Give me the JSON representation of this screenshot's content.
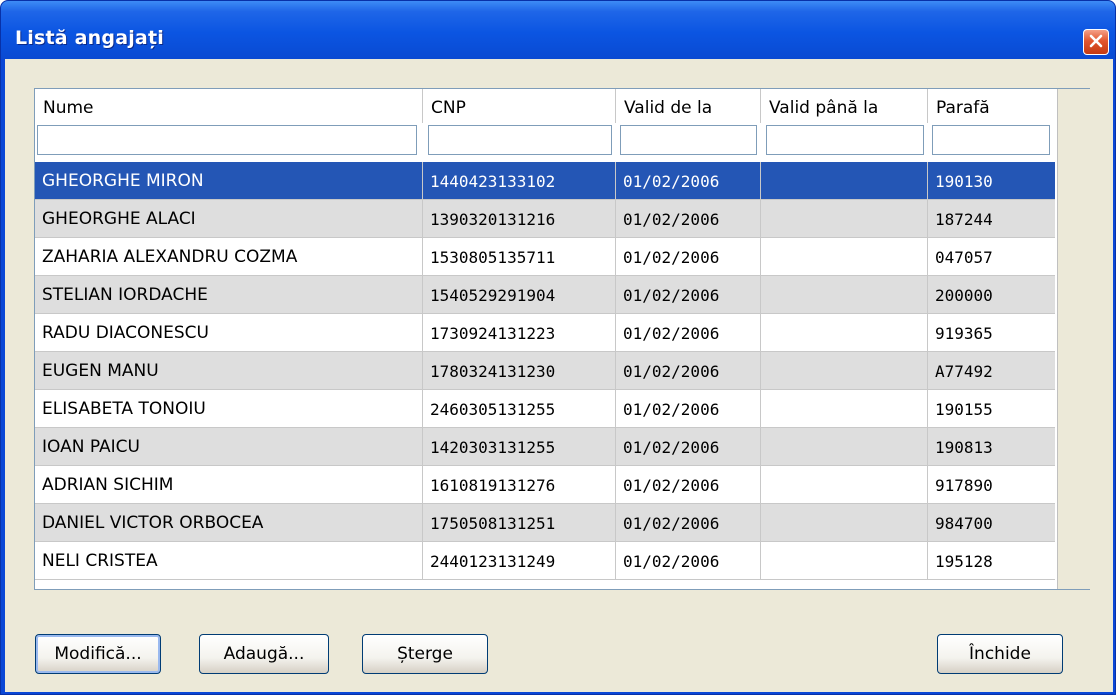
{
  "window": {
    "title": "Listă angajați",
    "close_icon": "close-icon"
  },
  "table": {
    "columns": [
      "Nume",
      "CNP",
      "Valid de la",
      "Valid până la",
      "Parafă"
    ],
    "filters": [
      "",
      "",
      "",
      "",
      ""
    ],
    "rows": [
      {
        "nume": "GHEORGHE MIRON",
        "cnp": "1440423133102",
        "valid_de_la": "01/02/2006",
        "valid_pana_la": "",
        "parafa": "190130"
      },
      {
        "nume": "GHEORGHE ALACI",
        "cnp": "1390320131216",
        "valid_de_la": "01/02/2006",
        "valid_pana_la": "",
        "parafa": "187244"
      },
      {
        "nume": "ZAHARIA ALEXANDRU COZMA",
        "cnp": "1530805135711",
        "valid_de_la": "01/02/2006",
        "valid_pana_la": "",
        "parafa": "047057"
      },
      {
        "nume": "STELIAN IORDACHE",
        "cnp": "1540529291904",
        "valid_de_la": "01/02/2006",
        "valid_pana_la": "",
        "parafa": "200000"
      },
      {
        "nume": "RADU DIACONESCU",
        "cnp": "1730924131223",
        "valid_de_la": "01/02/2006",
        "valid_pana_la": "",
        "parafa": "919365"
      },
      {
        "nume": "EUGEN MANU",
        "cnp": "1780324131230",
        "valid_de_la": "01/02/2006",
        "valid_pana_la": "",
        "parafa": "A77492"
      },
      {
        "nume": "ELISABETA TONOIU",
        "cnp": "2460305131255",
        "valid_de_la": "01/02/2006",
        "valid_pana_la": "",
        "parafa": "190155"
      },
      {
        "nume": "IOAN PAICU",
        "cnp": "1420303131255",
        "valid_de_la": "01/02/2006",
        "valid_pana_la": "",
        "parafa": "190813"
      },
      {
        "nume": "ADRIAN SICHIM",
        "cnp": "1610819131276",
        "valid_de_la": "01/02/2006",
        "valid_pana_la": "",
        "parafa": "917890"
      },
      {
        "nume": "DANIEL VICTOR ORBOCEA",
        "cnp": "1750508131251",
        "valid_de_la": "01/02/2006",
        "valid_pana_la": "",
        "parafa": "984700"
      },
      {
        "nume": "NELI CRISTEA",
        "cnp": "2440123131249",
        "valid_de_la": "01/02/2006",
        "valid_pana_la": "",
        "parafa": "195128"
      }
    ],
    "selected_index": 0
  },
  "buttons": {
    "modifica": "Modifică...",
    "adauga": "Adaugă...",
    "sterge": "Șterge",
    "inchide": "Închide"
  },
  "colors": {
    "selection": "#2456b5",
    "row_alt": "#dedede",
    "dialog_bg": "#ece9d8",
    "titlebar": "#0b55e2"
  }
}
